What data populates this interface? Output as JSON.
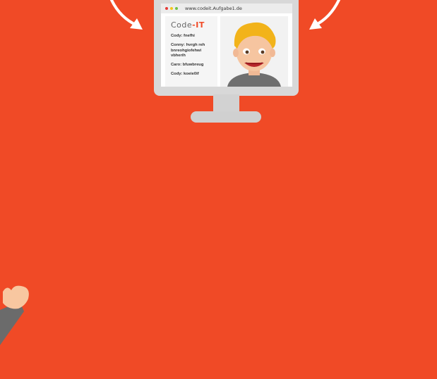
{
  "colors": {
    "background": "#f04a26",
    "monitor": "#d8d8d8",
    "accent": "#f04a26",
    "dot_red": "#e53935",
    "dot_yellow": "#f5c518",
    "dot_green": "#6cc04a"
  },
  "browser": {
    "url": "www.codeit.Aufgabe1.de"
  },
  "logo": {
    "prefix": "Code",
    "dash": "-",
    "suffix": "IT"
  },
  "messages": [
    "Cody:  fnefhi",
    "Conny: hvrgh reh bnreohgiofehwi vbherih",
    "Caro: bfuwbreug",
    "Cody: koeie0if"
  ],
  "icons": [
    "arrow-right-down-icon",
    "arrow-left-down-icon",
    "avatar-face-icon",
    "hand-icon"
  ]
}
